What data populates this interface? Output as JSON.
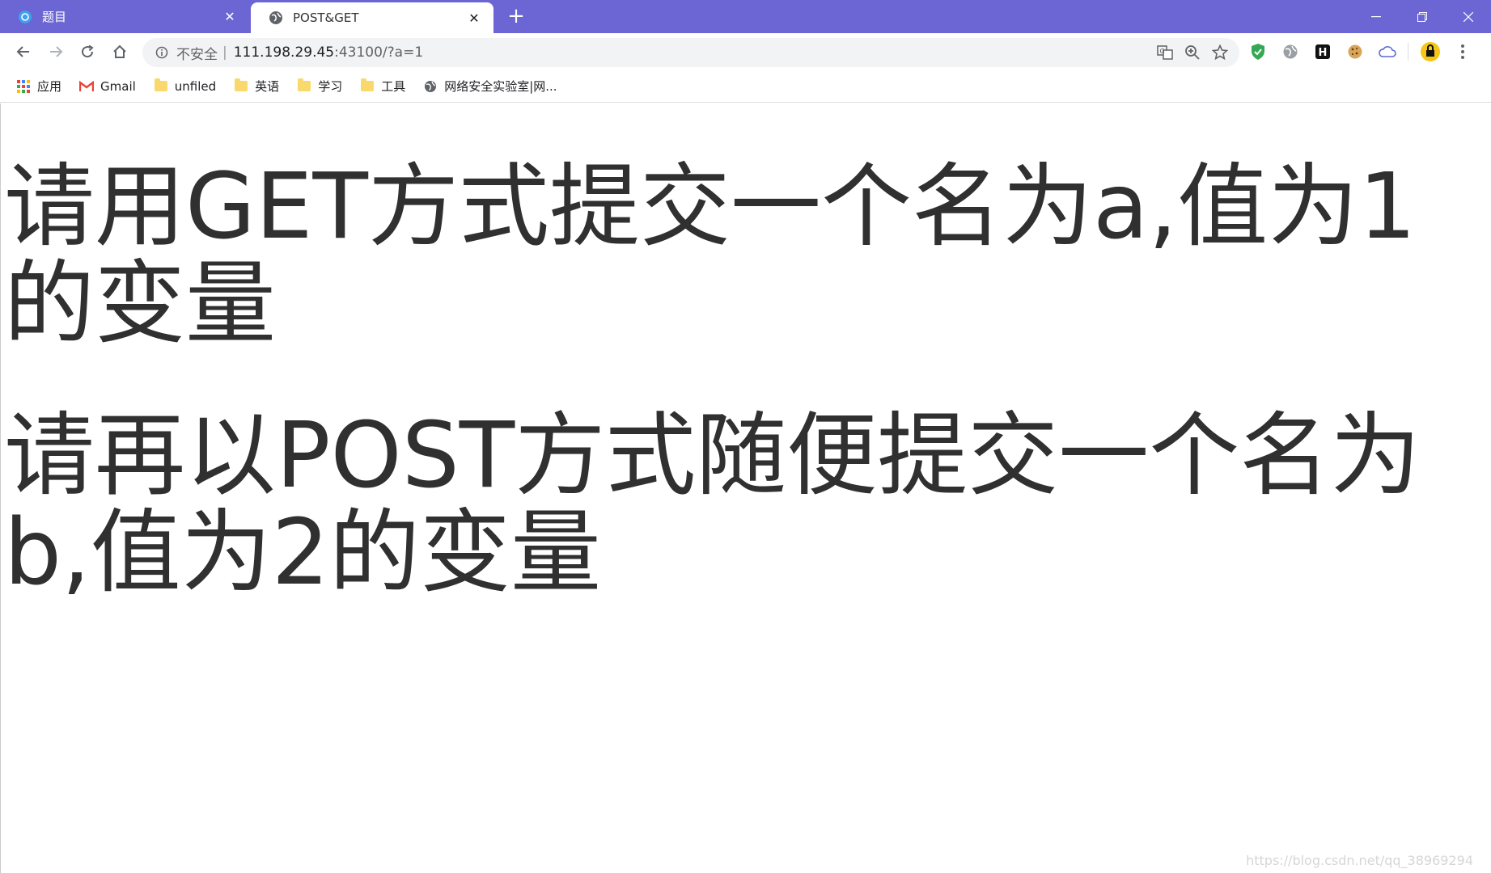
{
  "tabs": [
    {
      "title": "题目",
      "active": false
    },
    {
      "title": "POST&GET",
      "active": true
    }
  ],
  "toolbar": {
    "security_label": "不安全",
    "url_host": "111.198.29.45",
    "url_rest": ":43100/?a=1"
  },
  "bookmarks": [
    {
      "label": "应用",
      "icon": "apps-grid-icon"
    },
    {
      "label": "Gmail",
      "icon": "gmail-icon"
    },
    {
      "label": "unfiled",
      "icon": "folder-icon"
    },
    {
      "label": "英语",
      "icon": "folder-icon"
    },
    {
      "label": "学习",
      "icon": "folder-icon"
    },
    {
      "label": "工具",
      "icon": "folder-icon"
    },
    {
      "label": "网络安全实验室|网...",
      "icon": "globe-icon"
    }
  ],
  "page": {
    "line1": "请用GET方式提交一个名为a,值为1的变量",
    "line2": "请再以POST方式随便提交一个名为b,值为2的变量",
    "watermark": "https://blog.csdn.net/qq_38969294"
  },
  "colors": {
    "titlebar": "#6b66d3",
    "text": "#303030"
  }
}
